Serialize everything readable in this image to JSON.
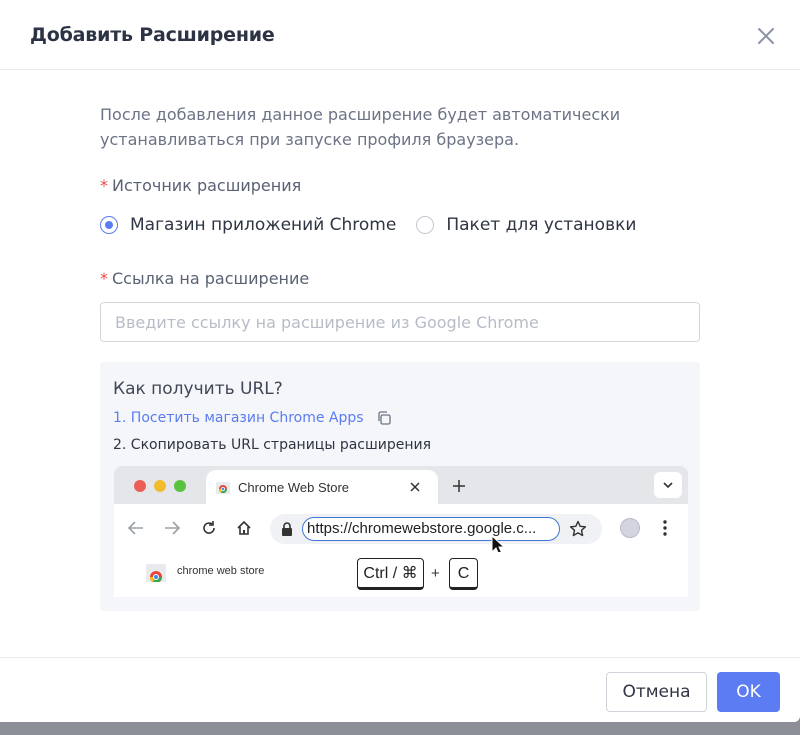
{
  "dialog": {
    "title": "Добавить Расширение",
    "description": "После добавления данное расширение будет автоматически устанавливаться при запуске профиля браузера.",
    "required_mark": "*",
    "source_label": "Источник расширения",
    "source_options": [
      {
        "label": "Магазин приложений Chrome",
        "checked": true
      },
      {
        "label": "Пакет для установки",
        "checked": false
      }
    ],
    "link_label": "Ссылка на расширение",
    "link_input": {
      "value": "",
      "placeholder": "Введите ссылку на расширение из Google Chrome"
    },
    "help": {
      "title": "Как получить URL?",
      "step1": "1. Посетить магазин Chrome Apps",
      "step2": "2. Скопировать URL страницы расширения"
    },
    "illustration": {
      "tab_title": "Chrome Web Store",
      "url": "https://chromewebstore.google.c...",
      "page_brand": "chrome web store",
      "key_ctrl": "Ctrl / ⌘",
      "plus": "+",
      "key_c": "C"
    },
    "buttons": {
      "cancel": "Отмена",
      "ok": "OK"
    }
  },
  "colors": {
    "accent": "#5b7cf3",
    "required": "#e64a4a"
  }
}
